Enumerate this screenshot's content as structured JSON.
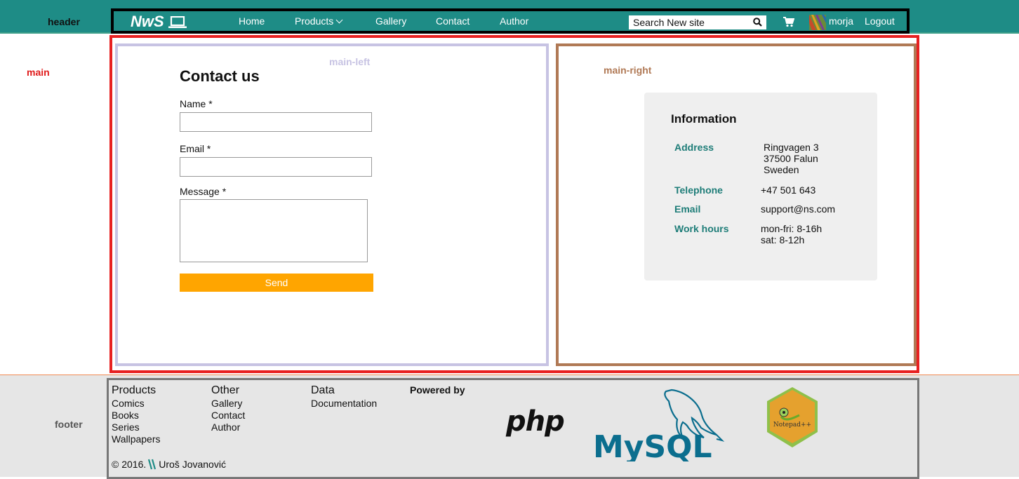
{
  "header": {
    "label": "header",
    "logo_text": "NwS",
    "nav": [
      "Home",
      "Products",
      "Gallery",
      "Contact",
      "Author"
    ],
    "search_placeholder": "Search New site",
    "username": "morja",
    "logout": "Logout"
  },
  "main": {
    "label": "main",
    "left_label": "main-left",
    "right_label": "main-right",
    "form": {
      "title": "Contact us",
      "name_label": "Name *",
      "email_label": "Email *",
      "message_label": "Message *",
      "send_label": "Send"
    },
    "info": {
      "title": "Information",
      "rows": [
        {
          "key": "Address",
          "value": "Ringvagen 3\n37500 Falun\nSweden"
        },
        {
          "key": "Telephone",
          "value": "+47 501 643"
        },
        {
          "key": "Email",
          "value": "support@ns.com"
        },
        {
          "key": "Work hours",
          "value": "mon-fri: 8-16h\nsat: 8-12h"
        }
      ]
    }
  },
  "footer": {
    "label": "footer",
    "columns": [
      {
        "head": "Products",
        "items": [
          "Comics",
          "Books",
          "Series",
          "Wallpapers"
        ]
      },
      {
        "head": "Other",
        "items": [
          "Gallery",
          "Contact",
          "Author"
        ]
      },
      {
        "head": "Data",
        "items": [
          "Documentation"
        ]
      }
    ],
    "powered_by": "Powered by",
    "copyright": "© 2016.",
    "author": "Uroš Jovanović",
    "php_logo_text": "php",
    "mysql_logo_text": "MySQL",
    "notepad_logo_text": "Notepad++"
  },
  "colors": {
    "header_bg": "#1e8c86",
    "accent_orange": "#ffa500",
    "info_key": "#1e7d78",
    "main_border": "#e72121"
  }
}
